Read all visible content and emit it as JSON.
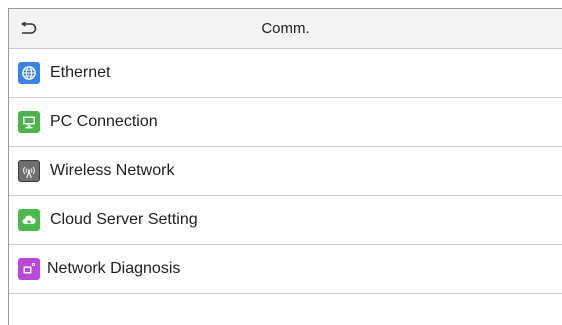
{
  "header": {
    "title": "Comm.",
    "back_icon": "back-arrow-icon"
  },
  "menu": {
    "items": [
      {
        "label": "Ethernet",
        "icon": "globe-icon",
        "color": "#3b82e6"
      },
      {
        "label": "PC Connection",
        "icon": "monitor-icon",
        "color": "#4db34d"
      },
      {
        "label": "Wireless Network",
        "icon": "wifi-tower-icon",
        "color": "#6e6e6e"
      },
      {
        "label": "Cloud Server Setting",
        "icon": "cloud-icon",
        "color": "#4fb84a"
      },
      {
        "label": "Network Diagnosis",
        "icon": "network-diagnosis-icon",
        "color": "#b949d6"
      }
    ]
  }
}
